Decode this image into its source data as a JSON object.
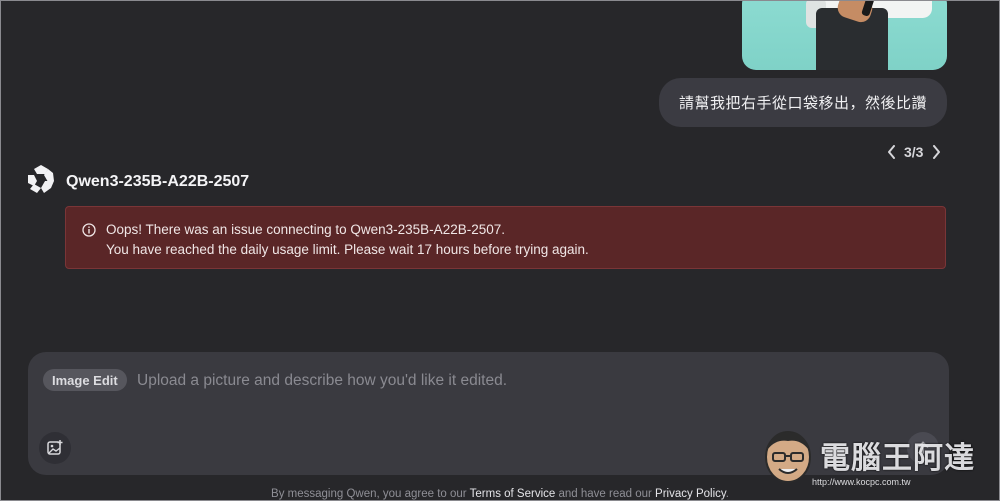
{
  "conversation": {
    "user_message": "請幫我把右手從口袋移出，然後比讚",
    "pager": {
      "current": "3/3"
    }
  },
  "assistant": {
    "name": "Qwen3-235B-A22B-2507",
    "logo_icon": "qwen-logo-icon"
  },
  "error": {
    "line1": "Oops! There was an issue connecting to Qwen3-235B-A22B-2507.",
    "line2": "You have reached the daily usage limit. Please wait 17 hours before trying again.",
    "icon": "info-icon",
    "bg_color": "#5a2627",
    "border_color": "#7a3537"
  },
  "composer": {
    "mode_label": "Image Edit",
    "placeholder": "Upload a picture and describe how you'd like it edited.",
    "value": "",
    "attach_icon": "image-upload-icon",
    "send_icon": "arrow-up-icon"
  },
  "footer": {
    "prefix": "By messaging Qwen, you agree to our",
    "terms_label": "Terms of Service",
    "middle": "and have read our",
    "privacy_label": "Privacy Policy",
    "suffix": "."
  },
  "watermark": {
    "text": "電腦王阿達",
    "url": "http://www.kocpc.com.tw"
  },
  "colors": {
    "background": "#27272a",
    "bubble": "#3b3b42",
    "composer": "#3a3a40"
  }
}
